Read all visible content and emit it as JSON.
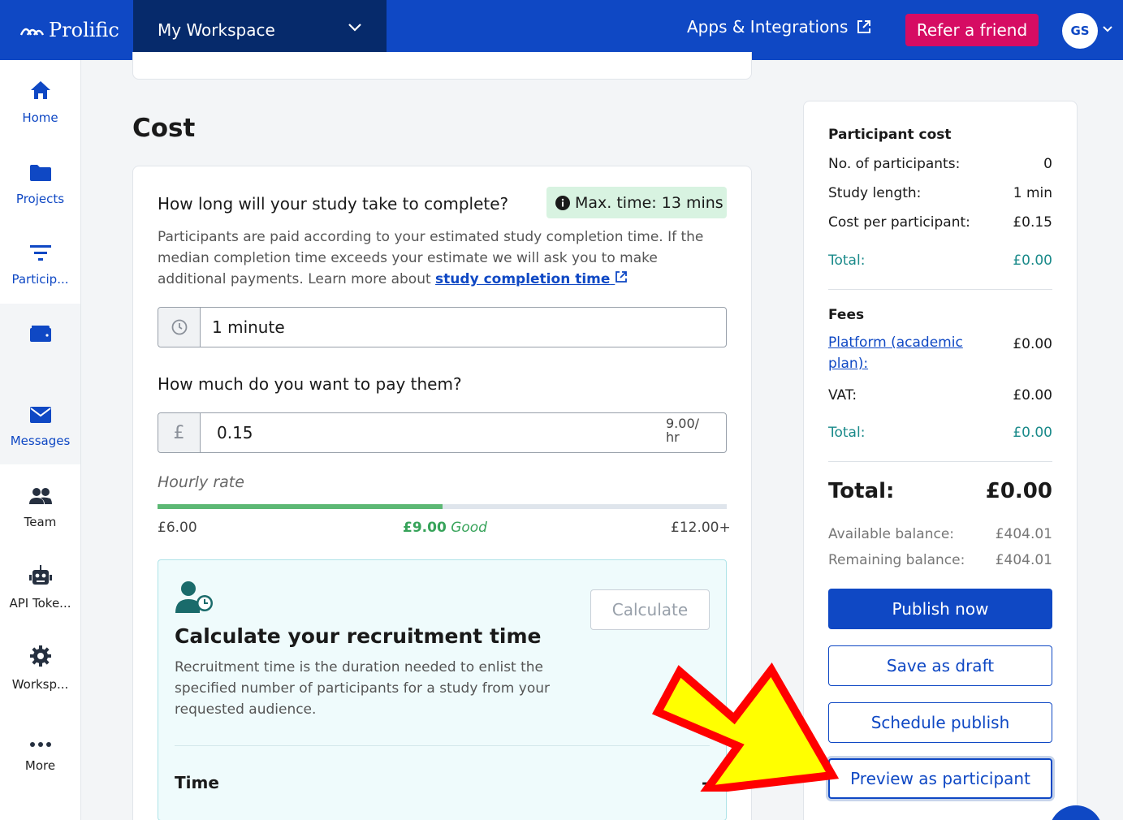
{
  "topbar": {
    "brand": "Prolific",
    "workspace": "My Workspace",
    "apps": "Apps & Integrations",
    "refer": "Refer a friend",
    "avatar": "GS"
  },
  "sidebar": {
    "items": [
      {
        "label": "Home",
        "icon": "home-icon"
      },
      {
        "label": "Projects",
        "icon": "folder-icon"
      },
      {
        "label": "Particip...",
        "icon": "filter-icon"
      },
      {
        "label": "",
        "icon": "wallet-icon"
      },
      {
        "label": "Messages",
        "icon": "envelope-icon"
      },
      {
        "label": "Team",
        "icon": "users-icon"
      },
      {
        "label": "API Toke...",
        "icon": "robot-icon"
      },
      {
        "label": "Worksp...",
        "icon": "gear-icon"
      },
      {
        "label": "More",
        "icon": "ellipsis-icon"
      }
    ]
  },
  "cost": {
    "title": "Cost",
    "q_duration": "How long will your study take to complete?",
    "max_time": "Max. time: 13 mins",
    "desc": "Participants are paid according to your estimated study completion time. If the median completion time exceeds your estimate we will ask you to make additional payments. Learn more about ",
    "desc_link": "study completion time",
    "duration_value": "1 minute",
    "q_pay": "How much do you want to pay them?",
    "currency": "£",
    "pay_value": "0.15",
    "pay_rate": "9.00/ hr",
    "hourly_label": "Hourly rate",
    "rate_min": "£6.00",
    "rate_mid": "£9.00",
    "rate_mid_label": "Good",
    "rate_max": "£12.00+",
    "rate_fill_fraction": 0.5
  },
  "recruit": {
    "calculate": "Calculate",
    "title": "Calculate your recruitment time",
    "desc": "Recruitment time is the duration needed to enlist the specified number of participants for a study from your requested audience.",
    "time_label": "Time",
    "time_value": "-"
  },
  "summary": {
    "participant_cost": "Participant cost",
    "n_label": "No. of participants:",
    "n_value": "0",
    "length_label": "Study length:",
    "length_value": "1 min",
    "cpp_label": "Cost per participant:",
    "cpp_value": "£0.15",
    "total_label": "Total:",
    "total_value": "£0.00",
    "fees": "Fees",
    "platform_label": "Platform (academic plan):",
    "platform_value": "£0.00",
    "vat_label": "VAT:",
    "vat_value": "£0.00",
    "fees_total_label": "Total:",
    "fees_total_value": "£0.00",
    "grand_label": "Total:",
    "grand_value": "£0.00",
    "avail_label": "Available balance:",
    "avail_value": "£404.01",
    "remain_label": "Remaining balance:",
    "remain_value": "£404.01",
    "publish": "Publish now",
    "draft": "Save as draft",
    "schedule": "Schedule publish",
    "preview": "Preview as participant"
  },
  "colors": {
    "brand": "#0f48c4",
    "refer": "#d60c63",
    "good": "#37a35a",
    "annotation_arrow": "#ffff00",
    "annotation_outline": "#ff0000"
  }
}
